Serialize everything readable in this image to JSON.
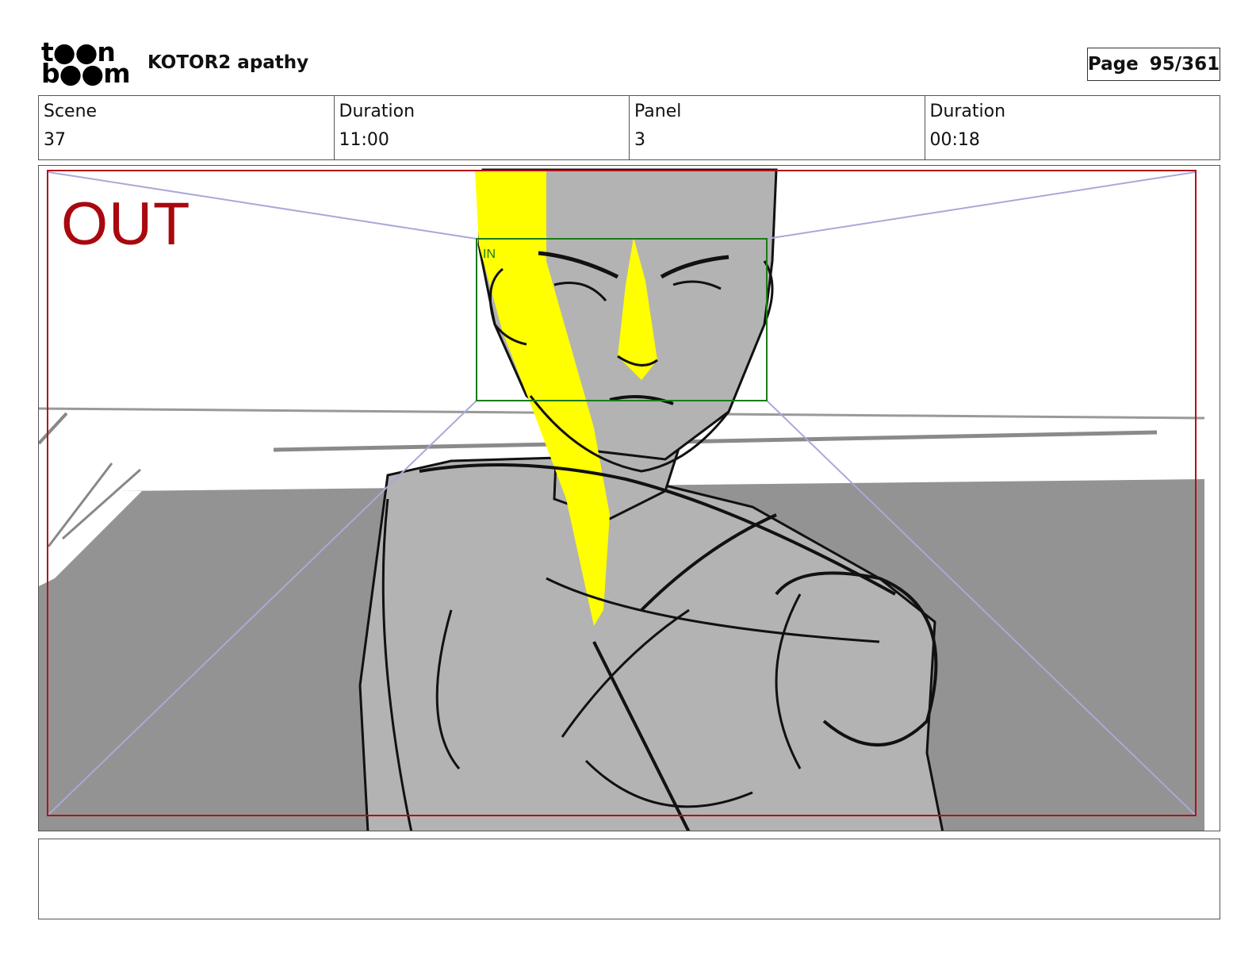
{
  "header": {
    "logo_line1": "t●●n",
    "logo_line2": "b●●m",
    "project_title": "KOTOR2 apathy",
    "page_label": "Page",
    "page_value": "95/361"
  },
  "info": {
    "scene_label": "Scene",
    "scene_value": "37",
    "duration_label": "Duration",
    "duration_value": "11:00",
    "panel_label": "Panel",
    "panel_value": "3",
    "panel_duration_label": "Duration",
    "panel_duration_value": "00:18"
  },
  "panel": {
    "out_label": "OUT",
    "in_label": "IN",
    "colors": {
      "out_frame": "#b0121a",
      "in_frame": "#1b7a1b",
      "perspective": "#a9a9d8",
      "highlight": "#ffff00",
      "skin_shade": "#b3b3b3",
      "floor": "#939393"
    }
  },
  "notes": {
    "text": ""
  }
}
